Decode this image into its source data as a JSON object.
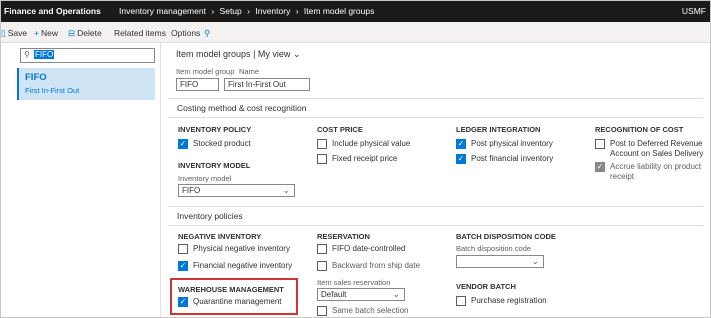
{
  "app_title": "Finance and Operations",
  "breadcrumb": [
    "Inventory management",
    "Setup",
    "Inventory",
    "Item model groups"
  ],
  "company": "USMF",
  "actions": {
    "save": "Save",
    "new": "New",
    "delete": "Delete",
    "related": "Related items",
    "options": "Options"
  },
  "filter_value": "FIFO",
  "list": [
    {
      "title": "FIFO",
      "subtitle": "First In-First Out"
    }
  ],
  "view": {
    "title": "Item model groups",
    "separator": "|",
    "name": "My view"
  },
  "header_fields": {
    "group_label": "Item model group",
    "group_value": "FIFO",
    "name_label": "Name",
    "name_value": "First In-First Out"
  },
  "fasttabs": [
    "Costing method & cost recognition",
    "Inventory policies"
  ],
  "costing": {
    "inventory_policy": "INVENTORY POLICY",
    "stocked_product": "Stocked product",
    "inventory_model": "INVENTORY MODEL",
    "inventory_model_label": "Inventory model",
    "inventory_model_value": "FIFO",
    "cost_price": "COST PRICE",
    "include_physical": "Include physical value",
    "fixed_receipt": "Fixed receipt price",
    "ledger": "LEDGER INTEGRATION",
    "post_physical": "Post physical inventory",
    "post_financial": "Post financial inventory",
    "recognition": "RECOGNITION OF COST",
    "post_deferred": "Post to Deferred Revenue Account on Sales Delivery",
    "accrue": "Accrue liability on product receipt"
  },
  "policies": {
    "negative": "NEGATIVE INVENTORY",
    "physical_negative": "Physical negative inventory",
    "financial_negative": "Financial negative inventory",
    "warehouse": "WAREHOUSE MANAGEMENT",
    "quarantine": "Quarantine management",
    "reservation": "RESERVATION",
    "fifo_date": "FIFO date-controlled",
    "backward": "Backward from ship date",
    "item_sales_res_label": "Item sales reservation",
    "item_sales_res_value": "Default",
    "same_batch": "Same batch selection",
    "batch_disp": "BATCH DISPOSITION CODE",
    "batch_disp_label": "Batch disposition code",
    "vendor_batch": "VENDOR BATCH",
    "purchase_reg": "Purchase registration"
  },
  "colors": {
    "accent": "#0078d4",
    "topbar": "#1b1a19",
    "highlight": "#d13438"
  },
  "icons": {
    "save": "save-icon",
    "new": "plus-icon",
    "delete": "trash-icon",
    "options": "search-icon",
    "checkmark": "checkmark-icon",
    "chevron": "chevron-down-icon",
    "breadcrumb_separator": "chevron-right-icon"
  }
}
